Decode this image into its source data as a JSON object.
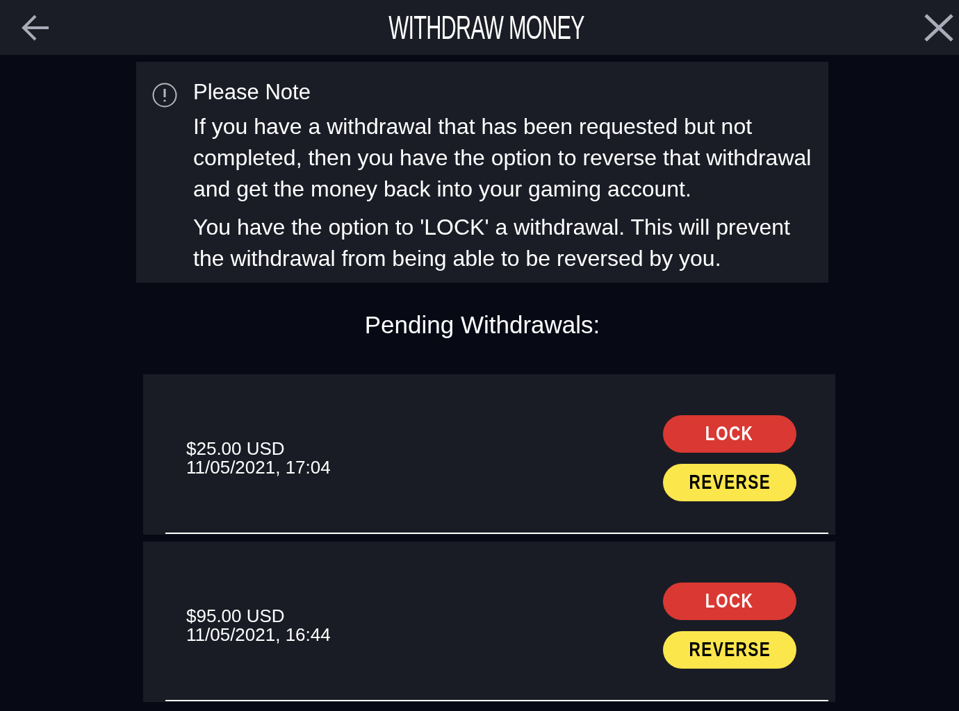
{
  "header": {
    "title": "WITHDRAW MONEY"
  },
  "note": {
    "title": "Please Note",
    "paragraphs": [
      "If you have a withdrawal that has been requested but not completed, then you have the option to reverse that withdrawal and get the money back into your gaming account.",
      "You have the option to 'LOCK' a withdrawal. This will prevent the withdrawal from being able to be reversed by you."
    ]
  },
  "pending": {
    "heading": "Pending Withdrawals:",
    "withdrawals": [
      {
        "amount": "$25.00 USD",
        "date": "11/05/2021, 17:04",
        "actions": [
          {
            "label": "LOCK",
            "kind": "lock"
          },
          {
            "label": "REVERSE",
            "kind": "reverse"
          }
        ]
      },
      {
        "amount": "$95.00 USD",
        "date": "11/05/2021, 16:44",
        "actions": [
          {
            "label": "LOCK",
            "kind": "lock"
          },
          {
            "label": "REVERSE",
            "kind": "reverse"
          }
        ]
      }
    ]
  }
}
